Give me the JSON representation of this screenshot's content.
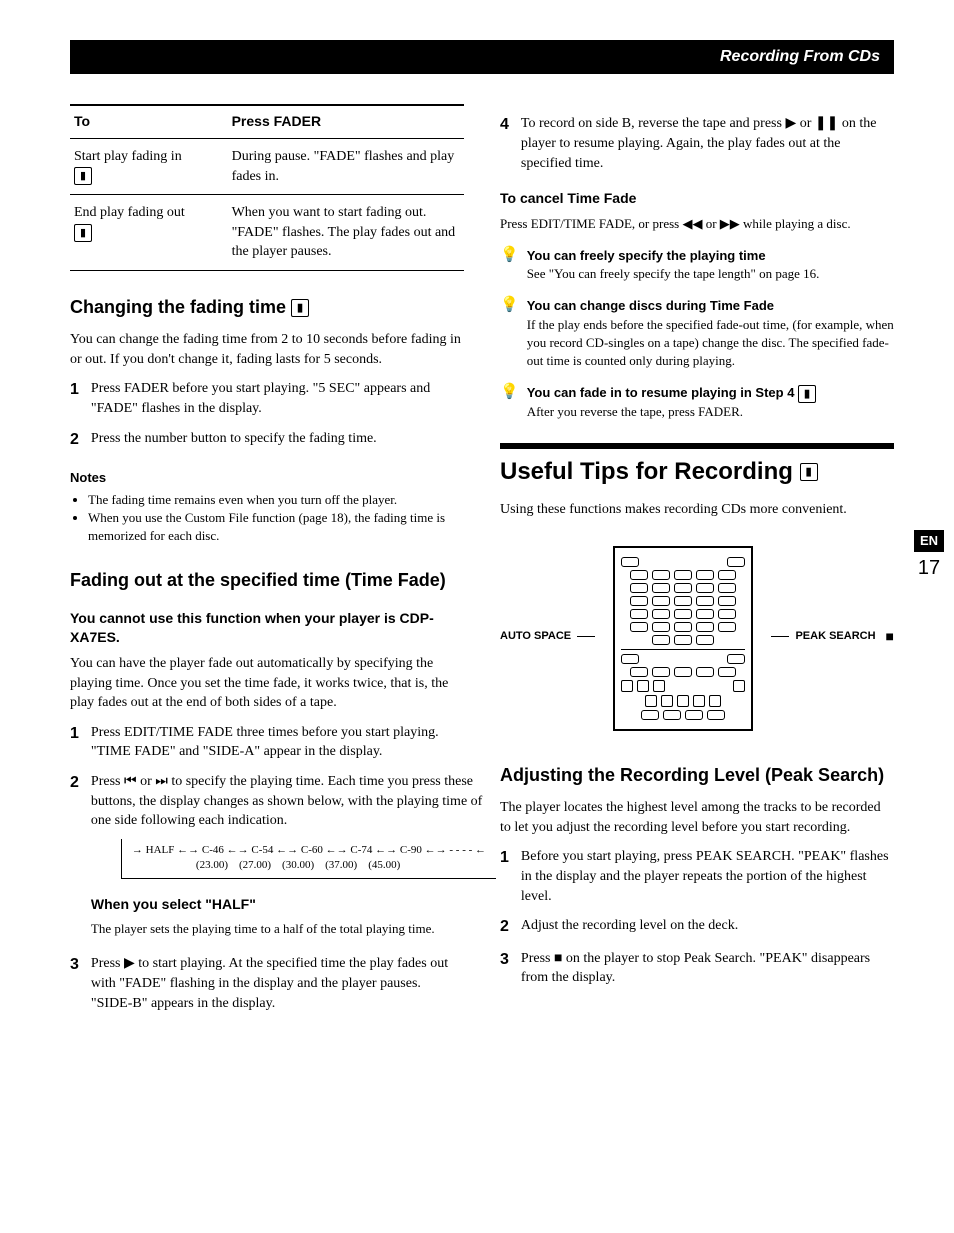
{
  "header": {
    "title": "Recording From CDs"
  },
  "page": {
    "lang": "EN",
    "num": "17"
  },
  "fader_table": {
    "h1": "To",
    "h2": "Press FADER",
    "r1c1": "Start play fading in",
    "r1c2": "During pause. \"FADE\" flashes and play fades in.",
    "r2c1": "End play fading out",
    "r2c2": "When you want to start fading out. \"FADE\" flashes. The play fades out and the player pauses."
  },
  "changing": {
    "title": "Changing the fading time ",
    "intro": "You can change the fading time from 2 to 10 seconds before fading in or out. If you don't change it, fading lasts for 5 seconds.",
    "step1": "Press FADER before you start playing. \"5 SEC\" appears and \"FADE\" flashes in the display.",
    "step2": "Press the number button to specify the fading time."
  },
  "notes": {
    "head": "Notes",
    "n1": "The fading time remains even when you turn off the player.",
    "n2": "When you use the Custom File function (page 18), the fading time is memorized for each disc."
  },
  "timefade": {
    "title": "Fading out at the specified time (Time Fade)",
    "warn": "You cannot use this function when your player is CDP-XA7ES.",
    "intro": "You can have the player fade out automatically by specifying the playing time. Once you set the time fade, it works twice, that is, the play fades out at the end of both sides of a tape.",
    "step1": "Press EDIT/TIME FADE three times before you start playing. \"TIME FADE\" and \"SIDE-A\" appear in the display.",
    "step2": "Press ⏮ or ⏭ to specify the playing time. Each time you press these buttons, the display changes as shown below, with the playing time of one side following each indication.",
    "seq1": "→ HALF ←→ C-46 ←→ C-54 ←→ C-60 ←→ C-74 ←→ C-90 ←→ - - - - ←",
    "seq2": "(23.00) (27.00) (30.00) (37.00) (45.00)",
    "half_head": "When you select \"HALF\"",
    "half_body": "The player sets the playing time to a half of the total playing time.",
    "step3": "Press ▶ to start playing. At the specified time the play fades out with \"FADE\" flashing in the display and the player pauses. \"SIDE-B\" appears in the display.",
    "step4": "To record on side B, reverse the tape and press ▶ or ❚❚ on the player to resume playing. Again, the play fades out at the specified time.",
    "cancel_head": "To cancel Time Fade",
    "cancel_body": "Press EDIT/TIME FADE, or press ◀◀ or ▶▶ while playing a disc."
  },
  "tips": {
    "t1_title": "You can freely specify the playing time",
    "t1_body": "See \"You can freely specify the tape length\" on page 16.",
    "t2_title": "You can change discs during Time Fade",
    "t2_body": "If the play ends before the specified fade-out time, (for example, when you record CD-singles on a tape) change the disc. The specified fade-out time is counted only during playing.",
    "t3_title": "You can fade in to resume playing in Step 4 ",
    "t3_body": "After you reverse the tape, press FADER."
  },
  "useful": {
    "title": "Useful Tips for Recording ",
    "intro": "Using these functions makes recording CDs more convenient.",
    "label_left": "AUTO SPACE",
    "label_right": "PEAK SEARCH"
  },
  "peak": {
    "title": "Adjusting the Recording Level (Peak Search)",
    "intro": "The player locates the highest level among the tracks to be recorded to let you adjust the recording level before you start recording.",
    "step1": "Before you start playing, press PEAK SEARCH. \"PEAK\" flashes in the display and the player repeats the portion of the highest level.",
    "step2": "Adjust the recording level on the deck.",
    "step3": "Press ■ on the player to stop Peak Search. \"PEAK\" disappears from the display."
  }
}
